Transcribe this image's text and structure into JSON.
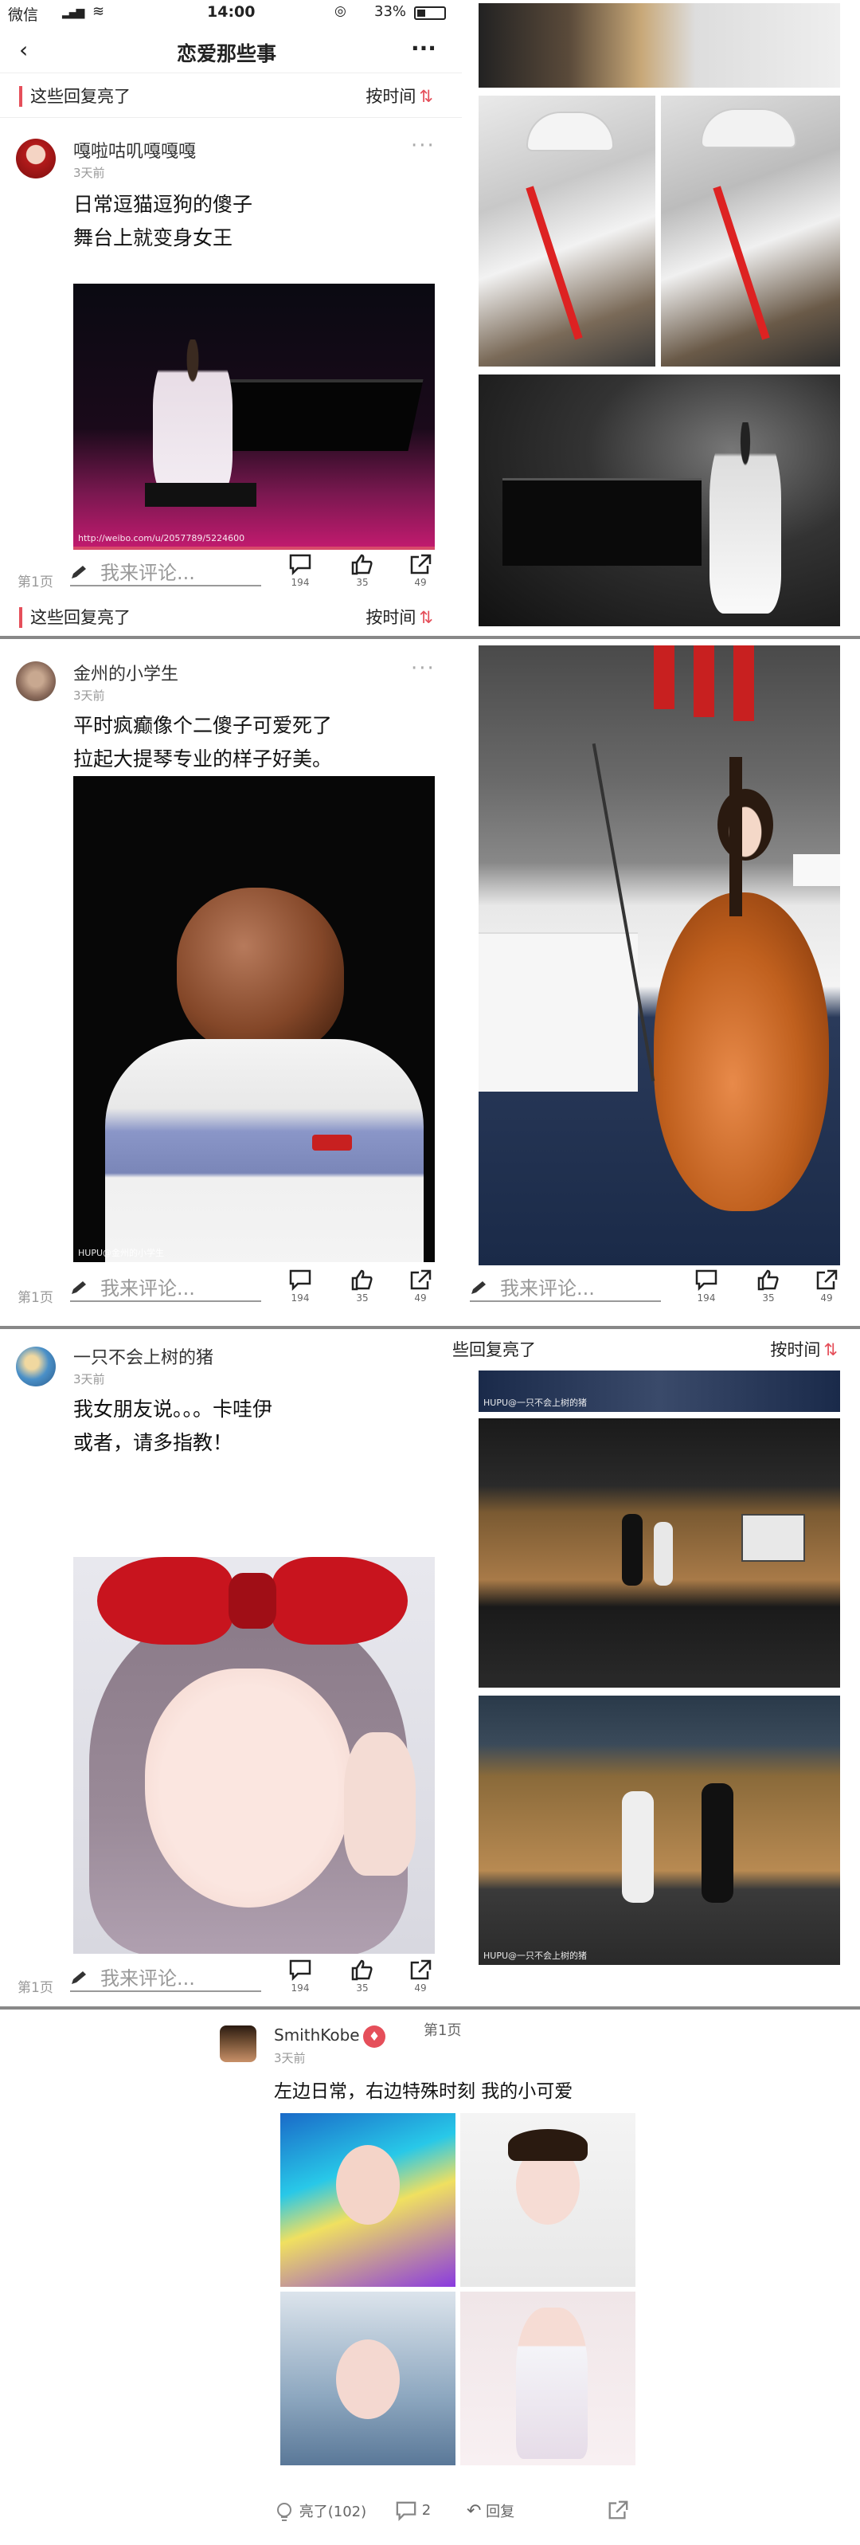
{
  "status_bar": {
    "carrier": "微信",
    "time": "14:00",
    "battery": "33%"
  },
  "nav": {
    "title": "恋爱那些事",
    "more": "···"
  },
  "hot": {
    "label": "这些回复亮了",
    "partial_label": "些回复亮了",
    "sort_label": "按时间",
    "sort_icon": "⇅"
  },
  "post_bar": {
    "page": "第1页",
    "comment_placeholder": "我来评论...",
    "comments": "194",
    "likes": "35",
    "shares": "49"
  },
  "posts": [
    {
      "user": "嘎啦咕叽嘎嘎嘎",
      "time": "3天前",
      "line1": "日常逗猫逗狗的傻子",
      "line2": "舞台上就变身女王",
      "watermark": "http://weibo.com/u/2057789/5224600"
    },
    {
      "user": "金州的小学生",
      "time": "3天前",
      "line1": "平时疯癫像个二傻子可爱死了",
      "line2": "拉起大提琴专业的样子好美。",
      "watermark": "HUPU@金州的小学生"
    },
    {
      "user": "一只不会上树的猪",
      "time": "3天前",
      "line1": "我女朋友说。。。卡哇伊",
      "line2": "或者，请多指教！",
      "watermark": "HUPU@一只不会上树的猪"
    }
  ],
  "smith": {
    "user": "SmithKobe",
    "time": "3天前",
    "page": "第1页",
    "text": "左边日常，右边特殊时刻 我的小可爱",
    "light": "亮了(102)",
    "comments": "2",
    "reply": "回复"
  },
  "colors": {
    "accent": "#e54f5a"
  }
}
